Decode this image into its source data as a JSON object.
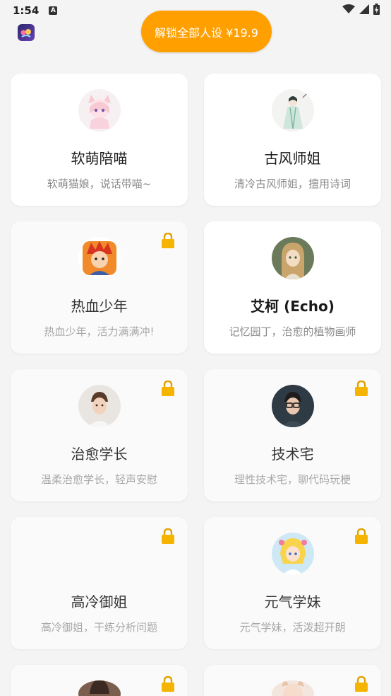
{
  "status_bar": {
    "time": "1:54",
    "badge": "A"
  },
  "header": {
    "unlock_label": "解锁全部人设 ¥19.9"
  },
  "cards": [
    {
      "title": "软萌陪喵",
      "desc": "软萌猫娘，说话带喵~",
      "locked": false
    },
    {
      "title": "古风师姐",
      "desc": "清冷古风师姐，擅用诗词",
      "locked": false
    },
    {
      "title": "热血少年",
      "desc": "热血少年，活力满满冲!",
      "locked": true
    },
    {
      "title": "艾柯 (Echo)",
      "desc": "记忆园丁，治愈的植物画师",
      "locked": false
    },
    {
      "title": "治愈学长",
      "desc": "温柔治愈学长，轻声安慰",
      "locked": true
    },
    {
      "title": "技术宅",
      "desc": "理性技术宅，聊代码玩梗",
      "locked": true
    },
    {
      "title": "高冷御姐",
      "desc": "高冷御姐，干练分析问题",
      "locked": true
    },
    {
      "title": "元气学妹",
      "desc": "元气学妹，活泼超开朗",
      "locked": true
    }
  ],
  "colors": {
    "accent": "#ff9f00",
    "lock": "#f5b400"
  }
}
